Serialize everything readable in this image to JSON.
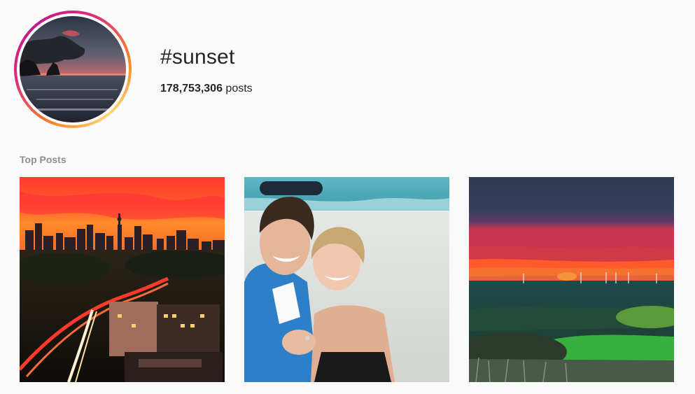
{
  "hashtag": {
    "title": "#sunset",
    "post_count": "178,753,306",
    "post_count_suffix": " posts"
  },
  "sections": {
    "top_posts_label": "Top Posts"
  },
  "top_posts": [
    {
      "subject": "city-skyline-sunset"
    },
    {
      "subject": "couple-beach-selfie"
    },
    {
      "subject": "wind-farm-sunset"
    }
  ],
  "colors": {
    "ring_gradient": [
      "#f58529",
      "#dd2a7b",
      "#c1178a",
      "#feda77"
    ],
    "text_primary": "#262626",
    "text_secondary": "#8e8e8e",
    "background": "#fafafa"
  }
}
